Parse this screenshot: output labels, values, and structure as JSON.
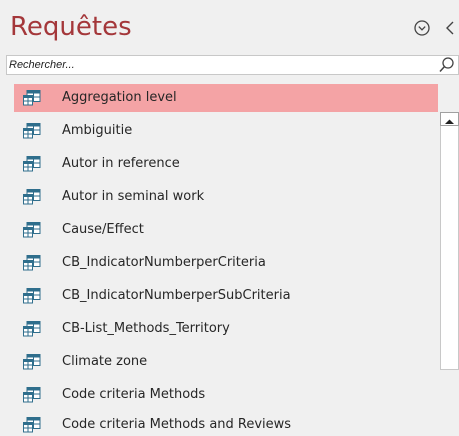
{
  "pane": {
    "title": "Requêtes",
    "menu_icon": "circle-chevron-down-icon",
    "collapse_icon": "chevron-left-icon"
  },
  "search": {
    "placeholder": "Rechercher...",
    "value": "",
    "icon": "search-icon"
  },
  "colors": {
    "title": "#a4373a",
    "selected_row": "#f4a3a5"
  },
  "queries": [
    {
      "label": "Aggregation level",
      "selected": true
    },
    {
      "label": "Ambiguitie",
      "selected": false
    },
    {
      "label": "Autor in reference",
      "selected": false
    },
    {
      "label": "Autor in seminal work",
      "selected": false
    },
    {
      "label": "Cause/Effect",
      "selected": false
    },
    {
      "label": "CB_IndicatorNumberperCriteria",
      "selected": false
    },
    {
      "label": "CB_IndicatorNumberperSubCriteria",
      "selected": false
    },
    {
      "label": "CB-List_Methods_Territory",
      "selected": false
    },
    {
      "label": "Climate zone",
      "selected": false
    },
    {
      "label": "Code criteria Methods",
      "selected": false
    },
    {
      "label": "Code criteria Methods and Reviews",
      "selected": false
    }
  ],
  "row_icon": "query-icon",
  "scrollbar": {
    "up_icon": "scroll-up-arrow-icon"
  }
}
